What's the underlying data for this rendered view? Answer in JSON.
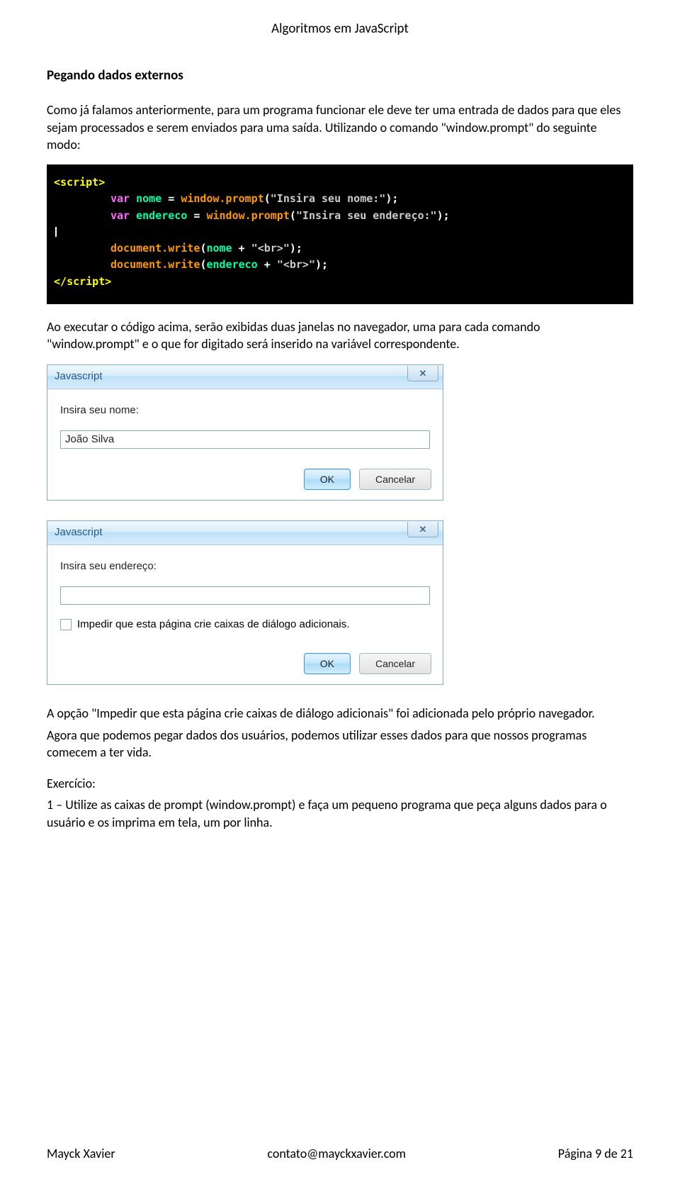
{
  "doc": {
    "title": "Algoritmos em JavaScript",
    "section_heading": "Pegando dados externos",
    "p1": "Como já falamos anteriormente, para um programa funcionar ele deve ter uma entrada de dados para que eles sejam processados e serem enviados para uma saída. Utilizando o comando \"window.prompt\" do seguinte modo:",
    "p2": "Ao executar o código acima, serão exibidas duas janelas no navegador, uma para cada comando \"window.prompt\" e o que for digitado será inserido na variável correspondente.",
    "p3": "A opção \"Impedir que esta página crie caixas de diálogo adicionais\" foi adicionada pelo próprio navegador.",
    "p4": "Agora que podemos pegar dados dos usuários, podemos utilizar esses dados para que nossos programas comecem a ter vida.",
    "exercise_label": "Exercício:",
    "exercise_text": "1 – Utilize as caixas de prompt (window.prompt) e faça um pequeno programa que peça alguns dados para o usuário e os imprima em tela, um por linha."
  },
  "code": {
    "open_tag_l": "<",
    "open_tag_name": "script",
    "open_tag_r": ">",
    "var_kw": "var",
    "nome_var": "nome",
    "eq": " = ",
    "win_prompt": "window.prompt",
    "paren_l": "(",
    "paren_r": ")",
    "semi": ";",
    "str_nome": "\"Insira seu nome:\"",
    "end_var": "endereco",
    "str_end": "\"Insira seu endereço:\"",
    "doc_write": "document.write",
    "plus": " + ",
    "br_str": "\"<br>\"",
    "close_tag_l": "</",
    "close_tag_r": ">"
  },
  "dialog1": {
    "title": "Javascript",
    "label": "Insira seu nome:",
    "value": "João Silva",
    "ok": "OK",
    "cancel": "Cancelar"
  },
  "dialog2": {
    "title": "Javascript",
    "label": "Insira seu endereço:",
    "value": "",
    "checkbox_label": "Impedir que esta página crie caixas de diálogo adicionais.",
    "ok": "OK",
    "cancel": "Cancelar"
  },
  "footer": {
    "author": "Mayck Xavier",
    "email": "contato@mayckxavier.com",
    "page": "Página 9 de 21"
  }
}
